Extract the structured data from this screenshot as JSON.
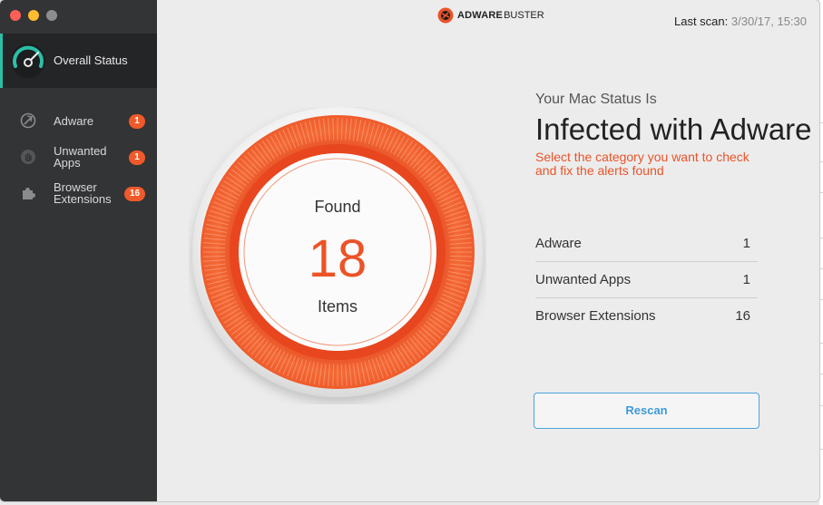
{
  "window": {
    "brand_main": "ADWARE",
    "brand_sub": "BUSTER",
    "last_scan_label": "Last scan:",
    "last_scan_value": "3/30/17, 15:30"
  },
  "sidebar": {
    "overall": {
      "label": "Overall Status",
      "icon": "gauge-icon"
    },
    "items": [
      {
        "label_line1": "Adware",
        "label_line2": "",
        "badge": "1",
        "icon": "adware-icon"
      },
      {
        "label_line1": "Unwanted",
        "label_line2": "Apps",
        "badge": "1",
        "icon": "hand-icon"
      },
      {
        "label_line1": "Browser",
        "label_line2": "Extensions",
        "badge": "16",
        "icon": "puzzle-icon"
      }
    ]
  },
  "summary": {
    "found_label": "Found",
    "count": "18",
    "unit_label": "Items"
  },
  "status": {
    "kicker": "Your Mac Status Is",
    "title": "Infected with Adware",
    "hint": "Select the category you want to check and fix the alerts found",
    "categories": [
      {
        "name": "Adware",
        "count": "1"
      },
      {
        "name": "Unwanted Apps",
        "count": "1"
      },
      {
        "name": "Browser Extensions",
        "count": "16"
      }
    ]
  },
  "actions": {
    "rescan_label": "Rescan"
  },
  "colors": {
    "accent_orange": "#ec5326",
    "accent_teal": "#2bbfa8",
    "accent_blue": "#3e9bd8",
    "sidebar_bg": "#333436"
  }
}
